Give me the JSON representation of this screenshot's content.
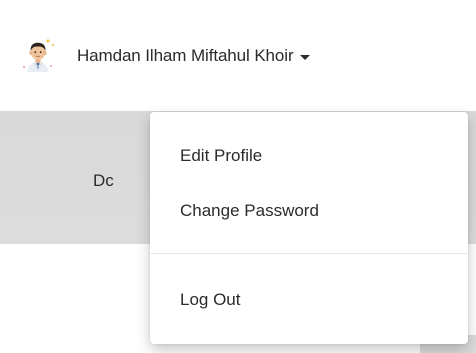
{
  "navbar": {
    "user_name": "Hamdan Ilham Miftahul Khoir"
  },
  "background": {
    "partial_text": "Dc"
  },
  "dropdown": {
    "items": [
      {
        "label": "Edit Profile"
      },
      {
        "label": "Change Password"
      },
      {
        "label": "Log Out"
      }
    ]
  },
  "colors": {
    "text": "#2b2b2b",
    "panel": "#dcdcdc",
    "menu_bg": "#ffffff",
    "divider": "#e6e6e6"
  },
  "icons": {
    "avatar": "user-avatar-icon",
    "caret": "caret-down-icon"
  }
}
